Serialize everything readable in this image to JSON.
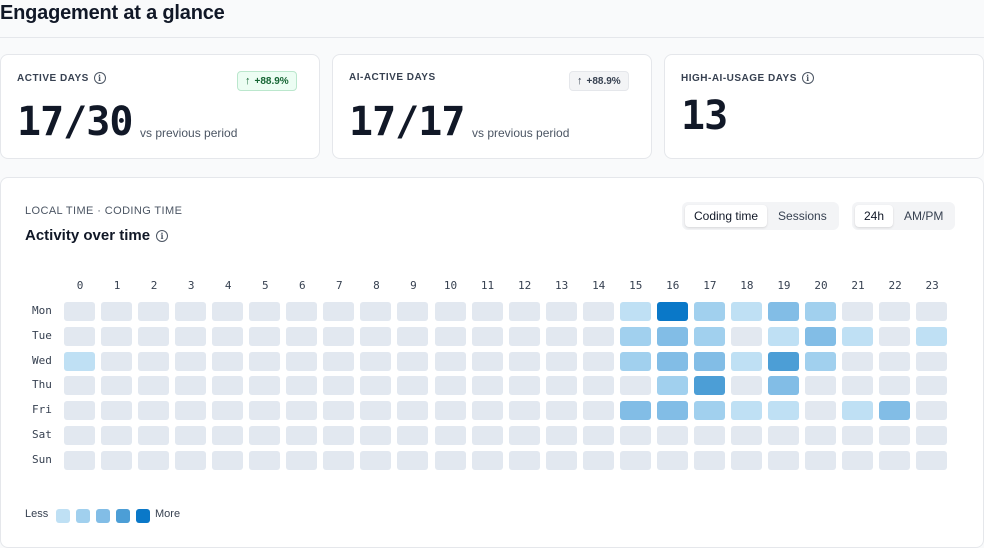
{
  "header": {
    "title": "Engagement at a glance"
  },
  "stats": [
    {
      "label": "ACTIVE DAYS",
      "value": "17/30",
      "sub": "vs previous period",
      "delta": "+88.9%",
      "delta_style": "green"
    },
    {
      "label": "AI-ACTIVE DAYS",
      "value": "17/17",
      "sub": "vs previous period",
      "delta": "+88.9%",
      "delta_style": "gray"
    },
    {
      "label": "HIGH-AI-USAGE DAYS",
      "value": "13"
    }
  ],
  "activity": {
    "eyebrow": "LOCAL TIME · CODING TIME",
    "title": "Activity over time",
    "metric_toggle": {
      "options": [
        "Coding time",
        "Sessions"
      ],
      "selected": "Coding time"
    },
    "clock_toggle": {
      "options": [
        "24h",
        "AM/PM"
      ],
      "selected": "24h"
    },
    "hours": [
      "0",
      "1",
      "2",
      "3",
      "4",
      "5",
      "6",
      "7",
      "8",
      "9",
      "10",
      "11",
      "12",
      "13",
      "14",
      "15",
      "16",
      "17",
      "18",
      "19",
      "20",
      "21",
      "22",
      "23"
    ],
    "days": [
      "Mon",
      "Tue",
      "Wed",
      "Thu",
      "Fri",
      "Sat",
      "Sun"
    ],
    "levels": [
      [
        0,
        0,
        0,
        0,
        0,
        0,
        0,
        0,
        0,
        0,
        0,
        0,
        0,
        0,
        0,
        1,
        5,
        2,
        1,
        3,
        2,
        0,
        0,
        0
      ],
      [
        0,
        0,
        0,
        0,
        0,
        0,
        0,
        0,
        0,
        0,
        0,
        0,
        0,
        0,
        0,
        2,
        3,
        2,
        0,
        1,
        3,
        1,
        0,
        1
      ],
      [
        1,
        0,
        0,
        0,
        0,
        0,
        0,
        0,
        0,
        0,
        0,
        0,
        0,
        0,
        0,
        2,
        3,
        3,
        1,
        4,
        2,
        0,
        0,
        0
      ],
      [
        0,
        0,
        0,
        0,
        0,
        0,
        0,
        0,
        0,
        0,
        0,
        0,
        0,
        0,
        0,
        0,
        2,
        4,
        0,
        3,
        0,
        0,
        0,
        0
      ],
      [
        0,
        0,
        0,
        0,
        0,
        0,
        0,
        0,
        0,
        0,
        0,
        0,
        0,
        0,
        0,
        3,
        3,
        2,
        1,
        1,
        0,
        1,
        3,
        0
      ],
      [
        0,
        0,
        0,
        0,
        0,
        0,
        0,
        0,
        0,
        0,
        0,
        0,
        0,
        0,
        0,
        0,
        0,
        0,
        0,
        0,
        0,
        0,
        0,
        0
      ],
      [
        0,
        0,
        0,
        0,
        0,
        0,
        0,
        0,
        0,
        0,
        0,
        0,
        0,
        0,
        0,
        0,
        0,
        0,
        0,
        0,
        0,
        0,
        0,
        0
      ]
    ],
    "palette": [
      "#e2e8f0",
      "#bfe0f4",
      "#a1d0ee",
      "#82bde6",
      "#4c9ed6",
      "#0a78c8"
    ],
    "legend": {
      "less": "Less",
      "more": "More"
    }
  }
}
